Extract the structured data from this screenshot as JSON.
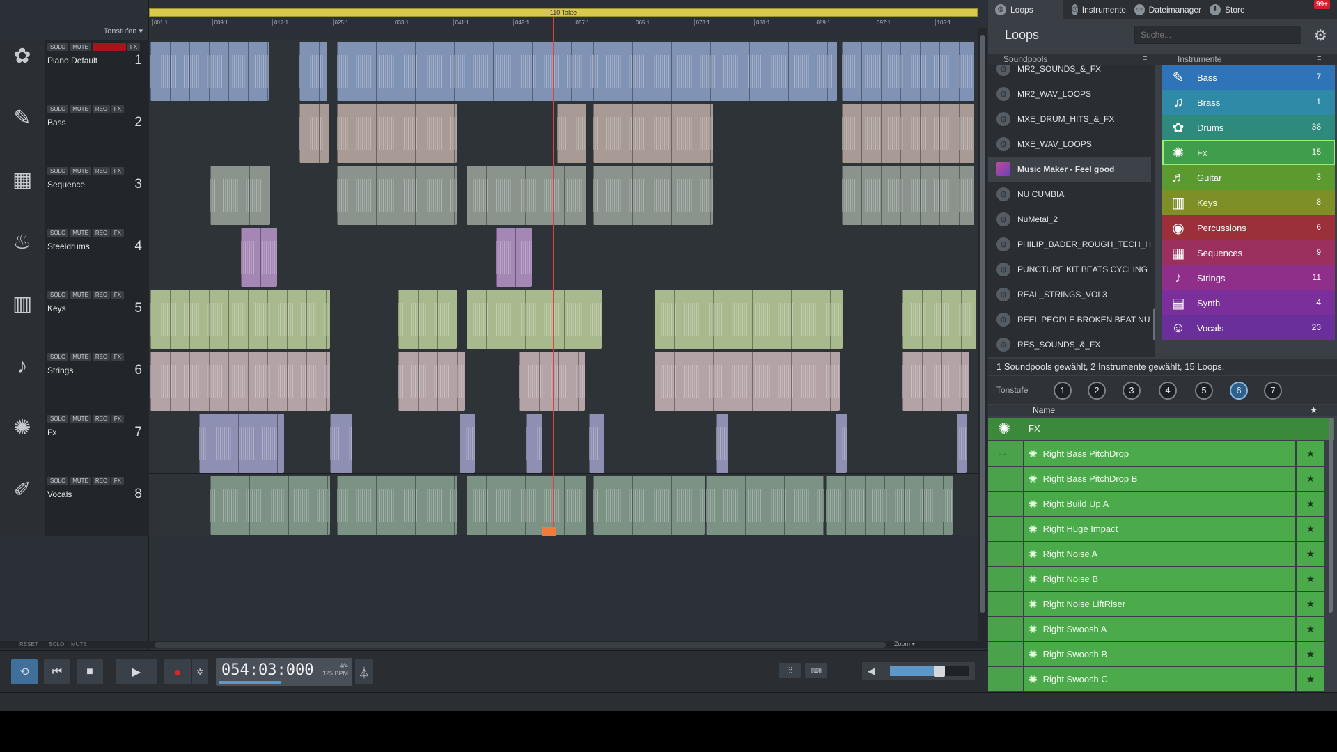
{
  "arranger": {
    "tonstufen_label": "Tonstufen",
    "tempo_bar_label": "110 Takte",
    "ruler_ticks": [
      "001:1",
      "009:1",
      "017:1",
      "025:1",
      "033:1",
      "041:1",
      "049:1",
      "057:1",
      "065:1",
      "073:1",
      "081:1",
      "089:1",
      "097:1",
      "105:1"
    ],
    "track_buttons": {
      "solo": "SOLO",
      "mute": "MUTE",
      "rec": "REC",
      "fx": "FX"
    },
    "tracks": [
      {
        "name": "Piano Default",
        "number": "1",
        "icon": "drums-icon",
        "color": "#8193b5"
      },
      {
        "name": "Bass",
        "number": "2",
        "icon": "bass-icon",
        "color": "#a89a95"
      },
      {
        "name": "Sequence",
        "number": "3",
        "icon": "sequencer-icon",
        "color": "#8a948d"
      },
      {
        "name": "Steeldrums",
        "number": "4",
        "icon": "steeldrum-icon",
        "color": "#a487b5"
      },
      {
        "name": "Keys",
        "number": "5",
        "icon": "keys-icon",
        "color": "#a8b98e"
      },
      {
        "name": "Strings",
        "number": "6",
        "icon": "strings-icon",
        "color": "#b4a3a6"
      },
      {
        "name": "Fx",
        "number": "7",
        "icon": "fx-icon",
        "color": "#8d8fb3"
      },
      {
        "name": "Vocals",
        "number": "8",
        "icon": "microphone-icon",
        "color": "#7b9285"
      }
    ],
    "bottom_labels": {
      "reset": "RESET",
      "solo": "SOLO",
      "mute": "MUTE",
      "zoom": "Zoom"
    }
  },
  "transport": {
    "time": "054:03:000",
    "time_signature": "4/4",
    "bpm": "125 BPM",
    "position_progress": 0.48,
    "volume_level": 0.62
  },
  "browser": {
    "tabs": [
      {
        "label": "Loops",
        "icon": "loops-icon",
        "active": true
      },
      {
        "label": "Instrumente",
        "icon": "instruments-icon",
        "active": false
      },
      {
        "label": "Dateimanager",
        "icon": "folder-icon",
        "active": false
      },
      {
        "label": "Store",
        "icon": "store-icon",
        "active": false
      }
    ],
    "notification_badge": "99+",
    "title": "Loops",
    "search_placeholder": "Suche...",
    "soundpools_heading": "Soundpools",
    "instruments_heading": "Instrumente",
    "soundpools": [
      {
        "label": "MR2_SOUNDS_&_FX",
        "selected": false
      },
      {
        "label": "MR2_WAV_LOOPS",
        "selected": false
      },
      {
        "label": "MXE_DRUM_HITS_&_FX",
        "selected": false
      },
      {
        "label": "MXE_WAV_LOOPS",
        "selected": false
      },
      {
        "label": "Music Maker - Feel good",
        "selected": true
      },
      {
        "label": "NU CUMBIA",
        "selected": false
      },
      {
        "label": "NuMetal_2",
        "selected": false
      },
      {
        "label": "PHILIP_BADER_ROUGH_TECH_H",
        "selected": false
      },
      {
        "label": "PUNCTURE KIT BEATS CYCLING",
        "selected": false
      },
      {
        "label": "REAL_STRINGS_VOL3",
        "selected": false
      },
      {
        "label": "REEL PEOPLE BROKEN BEAT NU",
        "selected": false
      },
      {
        "label": "RES_SOUNDS_&_FX",
        "selected": false
      }
    ],
    "instruments": [
      {
        "label": "Bass",
        "count": "7",
        "color": "#2f73b8",
        "icon": "bass-icon",
        "selected": false
      },
      {
        "label": "Brass",
        "count": "1",
        "color": "#2f8aa8",
        "icon": "brass-icon",
        "selected": false
      },
      {
        "label": "Drums",
        "count": "38",
        "color": "#2f8a7e",
        "icon": "drums-icon",
        "selected": false
      },
      {
        "label": "Fx",
        "count": "15",
        "color": "#3f9e4b",
        "icon": "fx-icon",
        "selected": true
      },
      {
        "label": "Guitar",
        "count": "3",
        "color": "#5a9a2e",
        "icon": "guitar-icon",
        "selected": false
      },
      {
        "label": "Keys",
        "count": "8",
        "color": "#7d8f26",
        "icon": "keys-icon",
        "selected": false
      },
      {
        "label": "Percussions",
        "count": "6",
        "color": "#9b2f3a",
        "icon": "percussion-icon",
        "selected": false
      },
      {
        "label": "Sequences",
        "count": "9",
        "color": "#9b2f5e",
        "icon": "sequencer-icon",
        "selected": false
      },
      {
        "label": "Strings",
        "count": "11",
        "color": "#8f2f8a",
        "icon": "strings-icon",
        "selected": false
      },
      {
        "label": "Synth",
        "count": "4",
        "color": "#7a2f9a",
        "icon": "synth-icon",
        "selected": false
      },
      {
        "label": "Vocals",
        "count": "23",
        "color": "#6a2f9a",
        "icon": "vocals-icon",
        "selected": false
      }
    ],
    "status": "1 Soundpools gewählt, 2 Instrumente gewählt, 15 Loops.",
    "tonstufe_label": "Tonstufe",
    "tonstufen": [
      {
        "label": "1",
        "selected": false
      },
      {
        "label": "2",
        "selected": false
      },
      {
        "label": "3",
        "selected": false
      },
      {
        "label": "4",
        "selected": false
      },
      {
        "label": "5",
        "selected": false
      },
      {
        "label": "6",
        "selected": true
      },
      {
        "label": "7",
        "selected": false
      }
    ],
    "list_name_header": "Name",
    "group_label": "FX",
    "loops": [
      "Right Bass PitchDrop",
      "Right Bass PitchDrop B",
      "Right Build Up A",
      "Right Huge Impact",
      "Right Noise A",
      "Right Noise B",
      "Right Noise LiftRiser",
      "Right Swoosh A",
      "Right Swoosh B",
      "Right Swoosh C"
    ]
  }
}
